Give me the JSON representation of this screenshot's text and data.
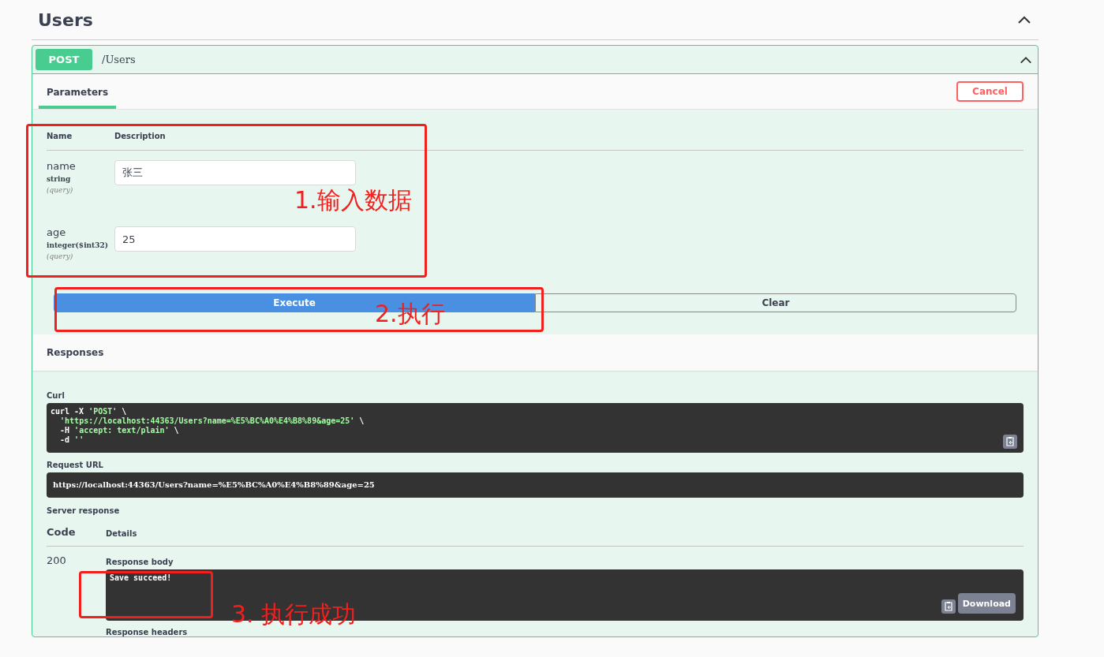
{
  "section": {
    "title": "Users",
    "expanded": true
  },
  "operation": {
    "method": "POST",
    "path": "/Users",
    "expanded": true
  },
  "tabs": [
    {
      "label": "Parameters",
      "selected": true
    }
  ],
  "cancel_button": "Cancel",
  "parameters": {
    "columns": [
      "Name",
      "Description"
    ],
    "rows": [
      {
        "name": "name",
        "type": "string",
        "location": "(query)",
        "value": "张三"
      },
      {
        "name": "age",
        "type": "integer($int32)",
        "location": "(query)",
        "value": "25"
      }
    ]
  },
  "buttons": {
    "execute": "Execute",
    "clear": "Clear"
  },
  "responses": {
    "title": "Responses",
    "curl_label": "Curl",
    "curl_lines": [
      {
        "plain": "curl -X ",
        "quoted": "'POST'",
        "tail": " \\"
      },
      {
        "quoted": "'https://localhost:44363/Users?name=%E5%BC%A0%E4%B8%89&age=25'",
        "tail": " \\"
      },
      {
        "plain": "  -H ",
        "quoted": "'accept: text/plain'",
        "tail": " \\"
      },
      {
        "plain": "  -d ",
        "quoted": "''"
      }
    ],
    "request_url_label": "Request URL",
    "request_url": "https://localhost:44363/Users?name=%E5%BC%A0%E4%B8%89&age=25",
    "server_response_label": "Server response",
    "columns": [
      "Code",
      "Details"
    ],
    "code": "200",
    "body_label": "Response body",
    "body": "Save succeed!",
    "download": "Download",
    "headers_label": "Response headers"
  },
  "annotations": [
    {
      "text": "1.输入数据"
    },
    {
      "text": "2.执行"
    },
    {
      "text": "3. 执行成功"
    }
  ]
}
